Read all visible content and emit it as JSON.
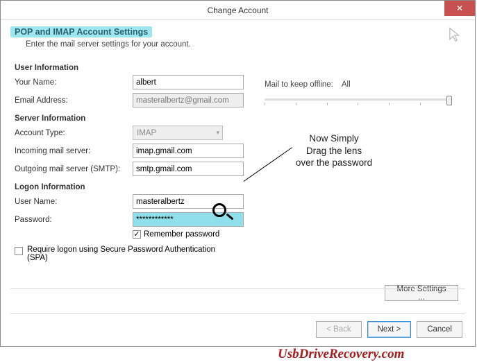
{
  "titlebar": {
    "title": "Change Account",
    "close": "✕"
  },
  "header": {
    "heading": "POP and IMAP Account Settings",
    "subtext": "Enter the mail server settings for your account."
  },
  "user_info": {
    "section": "User Information",
    "name_label": "Your Name:",
    "name_value": "albert",
    "email_label": "Email Address:",
    "email_value": "masteralbertz@gmail.com"
  },
  "server_info": {
    "section": "Server Information",
    "type_label": "Account Type:",
    "type_value": "IMAP",
    "incoming_label": "Incoming mail server:",
    "incoming_value": "imap.gmail.com",
    "outgoing_label": "Outgoing mail server (SMTP):",
    "outgoing_value": "smtp.gmail.com"
  },
  "logon": {
    "section": "Logon Information",
    "user_label": "User Name:",
    "user_value": "masteralbertz",
    "pass_label": "Password:",
    "pass_value": "************",
    "remember": "Remember password",
    "remember_checked": "✓",
    "spa": "Require logon using Secure Password Authentication (SPA)"
  },
  "offline": {
    "label": "Mail to keep offline:",
    "value": "All"
  },
  "callout": {
    "text1": "Now Simply",
    "text2": "Drag the lens",
    "text3": "over the password"
  },
  "buttons": {
    "more": "More Settings ...",
    "back": "< Back",
    "next": "Next >",
    "cancel": "Cancel"
  },
  "watermark": "UsbDriveRecovery.com"
}
